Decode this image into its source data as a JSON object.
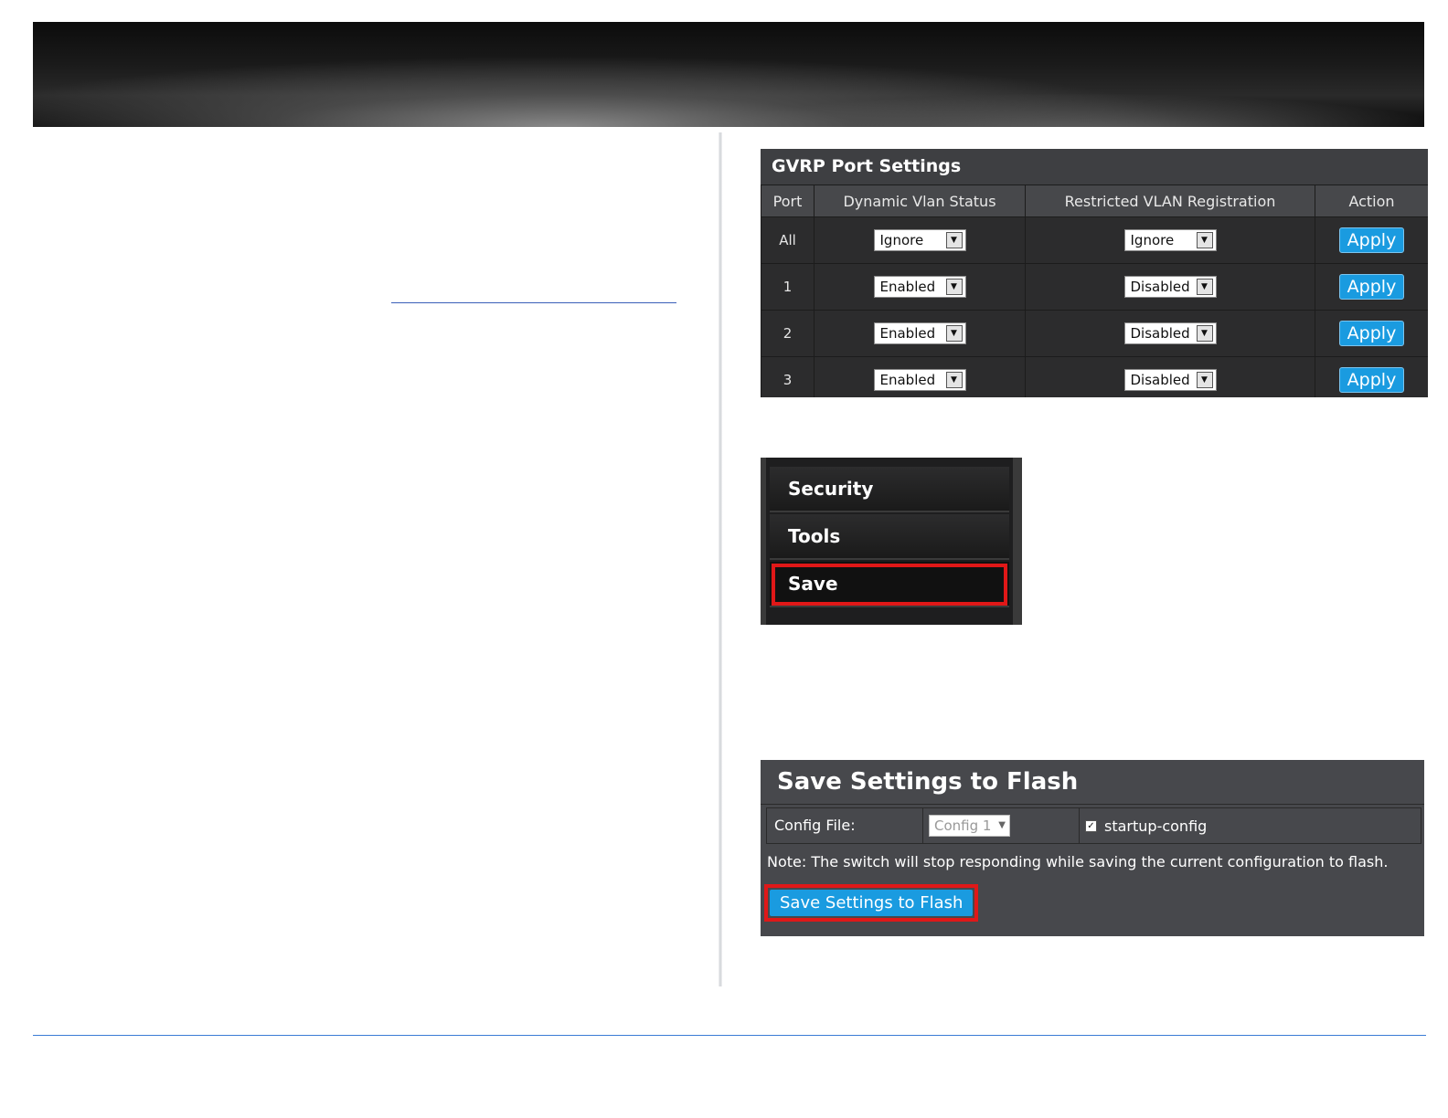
{
  "gvrp": {
    "title": "GVRP Port Settings",
    "headers": [
      "Port",
      "Dynamic Vlan Status",
      "Restricted VLAN Registration",
      "Action"
    ],
    "rows": [
      {
        "port": "All",
        "dynamic": "Ignore",
        "restricted": "Ignore",
        "action": "Apply"
      },
      {
        "port": "1",
        "dynamic": "Enabled",
        "restricted": "Disabled",
        "action": "Apply"
      },
      {
        "port": "2",
        "dynamic": "Enabled",
        "restricted": "Disabled",
        "action": "Apply"
      },
      {
        "port": "3",
        "dynamic": "Enabled",
        "restricted": "Disabled",
        "action": "Apply"
      }
    ]
  },
  "menu": {
    "items": [
      "Security",
      "Tools",
      "Save"
    ],
    "highlighted": "Save"
  },
  "save_panel": {
    "title": "Save Settings to Flash",
    "config_label": "Config File:",
    "config_value": "Config 1",
    "startup_label": "startup-config",
    "startup_checked": true,
    "note": "Note: The switch will stop responding while saving the current configuration to flash.",
    "button": "Save Settings to Flash"
  },
  "colors": {
    "accent": "#1a9be0",
    "highlight": "#e01818",
    "rule": "#3a7bd5"
  }
}
